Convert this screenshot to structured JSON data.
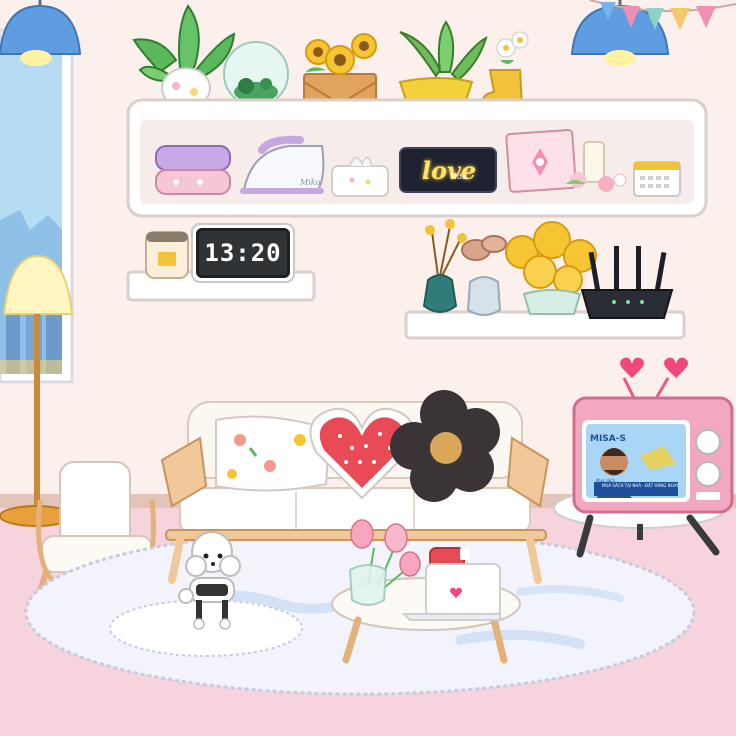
{
  "clock": {
    "time": "13:20"
  },
  "neon_sign": {
    "word": "love",
    "signature": "Mda"
  },
  "iron": {
    "brand": "Miko"
  },
  "tv": {
    "channel": "MISA-S",
    "caption": "Mua sách",
    "ticker": "MUA SÁCH TẠI NHÀ · ĐẶT HÀNG NGAY"
  },
  "colors": {
    "wall": "#fbf0ec",
    "floor": "#f7d3de",
    "shelf": "#ffffff",
    "tv_body": "#f2a8c0",
    "rug": "#f3f4fb",
    "sofa_frame": "#f0c89a"
  }
}
